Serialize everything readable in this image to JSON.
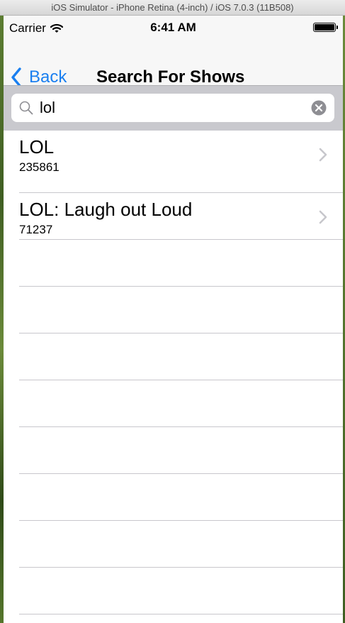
{
  "window": {
    "title": "iOS Simulator - iPhone Retina (4-inch) / iOS 7.0.3 (11B508)"
  },
  "status_bar": {
    "carrier": "Carrier",
    "time": "6:41 AM",
    "wifi_icon": "wifi-icon",
    "battery_icon": "battery-icon"
  },
  "nav_bar": {
    "back_label": "Back",
    "title": "Search For Shows",
    "accent_color": "#1a7ff0"
  },
  "search": {
    "value": "lol",
    "search_icon": "magnifier-icon",
    "clear_icon": "clear-circle-icon"
  },
  "results": [
    {
      "title": "LOL",
      "subtitle": "235861"
    },
    {
      "title": "LOL: Laugh out Loud",
      "subtitle": "71237"
    }
  ]
}
